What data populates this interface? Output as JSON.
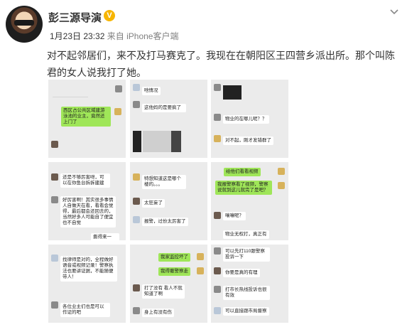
{
  "post": {
    "author_name": "彭三源导演",
    "verified_mark": "V",
    "date": "1月23日 23:32",
    "source_prefix": "来自",
    "source": "iPhone客户端",
    "text": "对不起邻居们，来不及打马赛克了。我现在在朝阳区王四营乡派出所。那个叫陈君的女人说我打了她。"
  },
  "icons": {
    "avatar": "avatar",
    "verified": "verified-badge-icon",
    "menu": "chevron-down-icon"
  },
  "colors": {
    "verified": "#f7b500",
    "chat_bg": "#ebebeb",
    "bubble_green": "#9fe658"
  },
  "screenshots": [
    {
      "messages": [
        "西区占公共区域建游泳池的业主，竟然还上门了"
      ]
    },
    {
      "messages": [
        "啥情况",
        "这他妈的是要疯了"
      ]
    },
    {
      "messages": [
        "物业的在哪儿呢？？",
        "对不起，刚才发错群了"
      ]
    },
    {
      "messages": [
        "还是不够厉害呀，可以在你鱼台拆拆建建",
        "好厉害啊！其实很多事情人自做天在看，看看会觉得，最后都会还回去的，当然好多人可能自了便宜也不自觉",
        "撕得来一"
      ]
    },
    {
      "messages": [
        "特想知道这是哪个楼的。。。",
        "太狂妄了",
        "报警，过份太厉害了"
      ]
    },
    {
      "messages": [
        "给他们看看视频",
        "我报警察看了视频，警察说就到这儿就完了是吧？",
        "嚷嚷呢？",
        "物业无权打，真正有"
      ]
    },
    {
      "messages": [
        "找律师是对的，全程做好语音或视频记录！警察执法也要讲证据，不能随便带人！",
        "各位业主们也是可以作证的吧"
      ]
    },
    {
      "messages": [
        "我家监控坏了",
        "我得撤警察走",
        "打了没有 看人不就知道了啊",
        "身上有没有伤"
      ]
    },
    {
      "messages": [
        "可以先打110跟警察投诉一下",
        "你要是真的有理",
        "打市长热线投诉也很有效",
        "可以直接跟市局督察"
      ]
    }
  ]
}
